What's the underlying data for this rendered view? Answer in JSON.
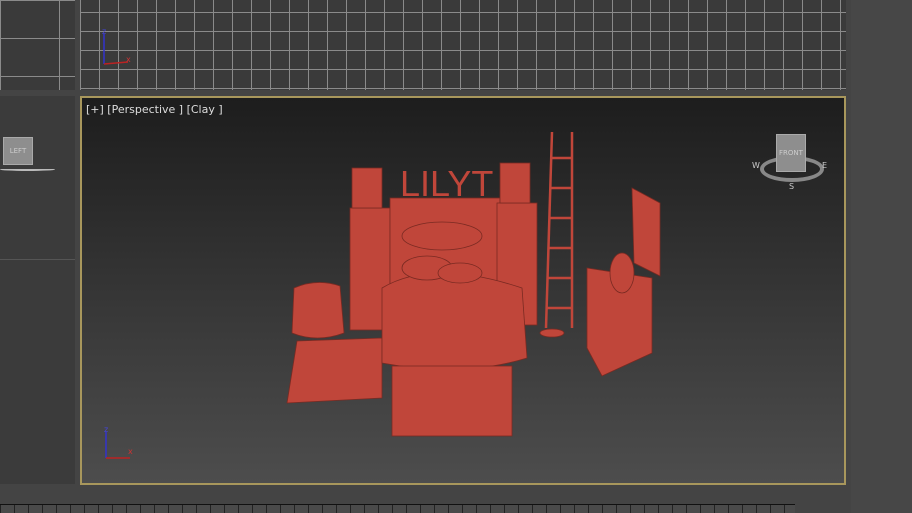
{
  "viewports": {
    "perspective": {
      "label": "[+] [Perspective ] [Clay ]",
      "scene_text": "LILYT"
    },
    "left": {
      "viewcube_label": "LEFT"
    },
    "viewcube": {
      "face": "FRONT",
      "compass": [
        "W",
        "E",
        "S"
      ]
    },
    "axis": {
      "x": "x",
      "y": "y",
      "z": "z"
    }
  },
  "colors": {
    "border_active": "#a8975c",
    "clay": "#c0463a"
  }
}
